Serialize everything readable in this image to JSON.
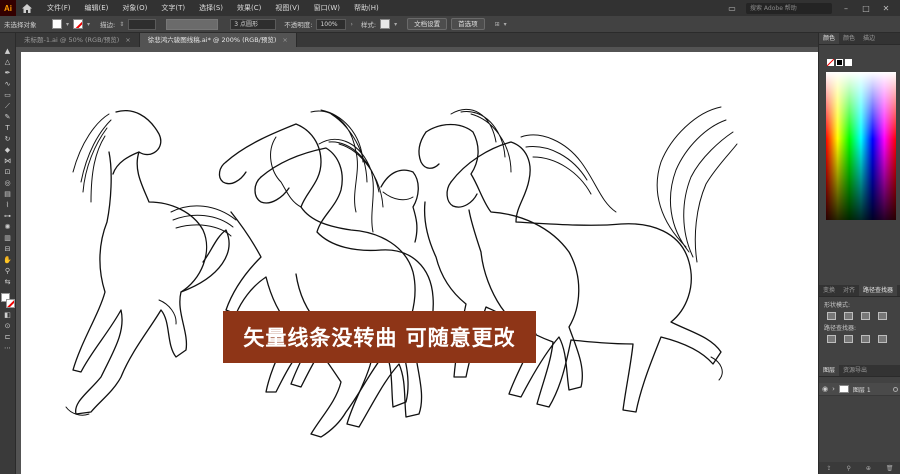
{
  "app": {
    "logo": "Ai"
  },
  "menubar": {
    "items": [
      "文件(F)",
      "编辑(E)",
      "对象(O)",
      "文字(T)",
      "选择(S)",
      "效果(C)",
      "视图(V)",
      "窗口(W)",
      "帮助(H)"
    ],
    "search_placeholder": "搜索 Adobe 帮助"
  },
  "controlbar": {
    "selection_label": "未选择对象",
    "stroke_label": "描边:",
    "brush_value": "3 点圆形",
    "opacity_label": "不透明度:",
    "opacity_value": "100%",
    "style_label": "样式:",
    "doc_settings": "文档设置",
    "preferences": "首选项"
  },
  "tabs": [
    {
      "label": "未标题-1.ai @ 50% (RGB/预览)",
      "active": false
    },
    {
      "label": "徐悲鸿六骏图线稿.ai* @ 200% (RGB/预览)",
      "active": true
    }
  ],
  "canvas": {
    "banner_text": "矢量线条没转曲 可随意更改",
    "banner_color": "#8e3517"
  },
  "panels": {
    "color_tabs": [
      "颜色",
      "颜色",
      "描边"
    ],
    "path_tabs": [
      "变换",
      "对齐",
      "路径查找器"
    ],
    "shape_modes_label": "形状模式:",
    "pathfinder_label": "路径查找器:",
    "layers_tabs": [
      "图层",
      "资源导出"
    ],
    "layer_name": "图层 1"
  }
}
